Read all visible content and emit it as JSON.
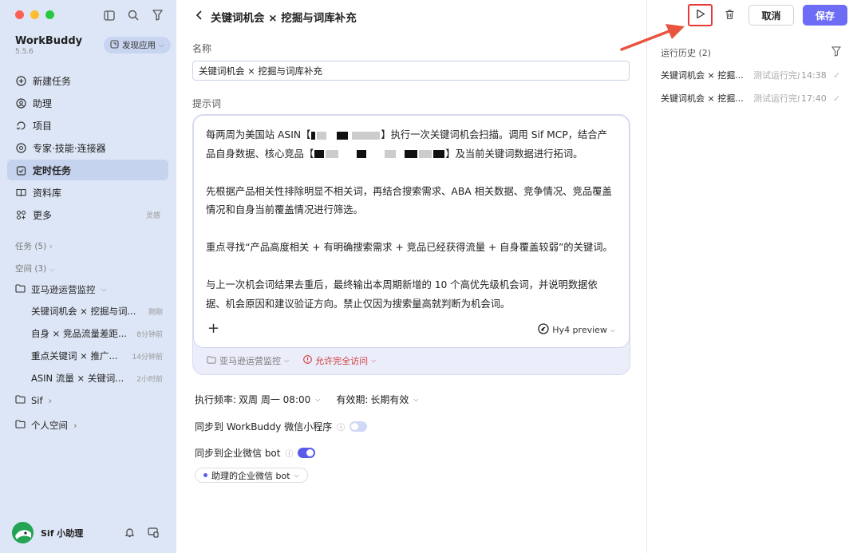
{
  "app": {
    "name": "WorkBuddy",
    "version": "5.5.6",
    "discover_label": "发现应用"
  },
  "sidebar": {
    "nav": [
      {
        "label": "新建任务",
        "icon": "plus-circle-icon"
      },
      {
        "label": "助理",
        "icon": "assistant-icon"
      },
      {
        "label": "项目",
        "icon": "project-icon"
      },
      {
        "label": "专家·技能·连接器",
        "icon": "expert-icon"
      },
      {
        "label": "定时任务",
        "icon": "scheduled-icon",
        "active": true
      },
      {
        "label": "资料库",
        "icon": "book-icon"
      },
      {
        "label": "更多",
        "icon": "more-icon",
        "extra": "灵感"
      }
    ],
    "tasks_section": "任务 (5)",
    "spaces_section": "空间 (3)",
    "space_amazon": "亚马逊运营监控",
    "tasks": [
      {
        "name": "关键词机会 × 挖掘与词...",
        "time": "刚刚"
      },
      {
        "name": "自身 × 竞品流量差距...",
        "time": "8分钟前"
      },
      {
        "name": "重点关键词 × 推广...",
        "time": "14分钟前"
      },
      {
        "name": "ASIN 流量 × 关键词...",
        "time": "2小时前"
      }
    ],
    "space_sif": "Sif",
    "space_personal": "个人空间",
    "user_name": "Sif 小助理"
  },
  "header": {
    "title": "关键词机会 × 挖掘与词库补充",
    "cancel": "取消",
    "save": "保存"
  },
  "form": {
    "name_label": "名称",
    "name_value": "关键词机会 × 挖掘与词库补充",
    "prompt_label": "提示词",
    "prompt": {
      "p1a": "每两周为美国站 ASIN【",
      "p1b": "】执行一次关键词机会扫描。调用 Sif MCP，结合产品自身数据、核心竞品【",
      "p1c": "】及当前关键词数据进行拓词。",
      "p2": "先根据产品相关性排除明显不相关词，再结合搜索需求、ABA 相关数据、竞争情况、竞品覆盖情况和自身当前覆盖情况进行筛选。",
      "p3": "重点寻找“产品高度相关 + 有明确搜索需求 + 竞品已经获得流量 + 自身覆盖较弱”的关键词。",
      "p4": "与上一次机会词结果去重后，最终输出本周期新增的 10 个高优先级机会词，并说明数据依据、机会原因和建议验证方向。禁止仅因为搜索量高就判断为机会词。"
    },
    "model": "Hy4 preview",
    "workspace": "亚马逊运营监控",
    "access": "允许完全访问",
    "freq_label": "执行频率:",
    "freq_value": "双周 周一 08:00",
    "valid_label": "有效期:",
    "valid_value": "长期有效",
    "sync_wechat_mini": "同步到 WorkBuddy 微信小程序",
    "sync_wechat_mini_on": false,
    "sync_wecom_bot": "同步到企业微信 bot",
    "sync_wecom_bot_on": true,
    "bot_chip": "助理的企业微信 bot"
  },
  "history": {
    "title": "运行历史 (2)",
    "runs": [
      {
        "name": "关键词机会 × 挖掘...",
        "status": "测试运行完成",
        "time": "14:38"
      },
      {
        "name": "关键词机会 × 挖掘...",
        "status": "测试运行完成",
        "time": "17:40"
      }
    ]
  },
  "colors": {
    "accent": "#6c6cf4",
    "sidebar_bg": "#dde6f6",
    "danger": "#e53935",
    "toggle_on": "#5b5bea"
  }
}
